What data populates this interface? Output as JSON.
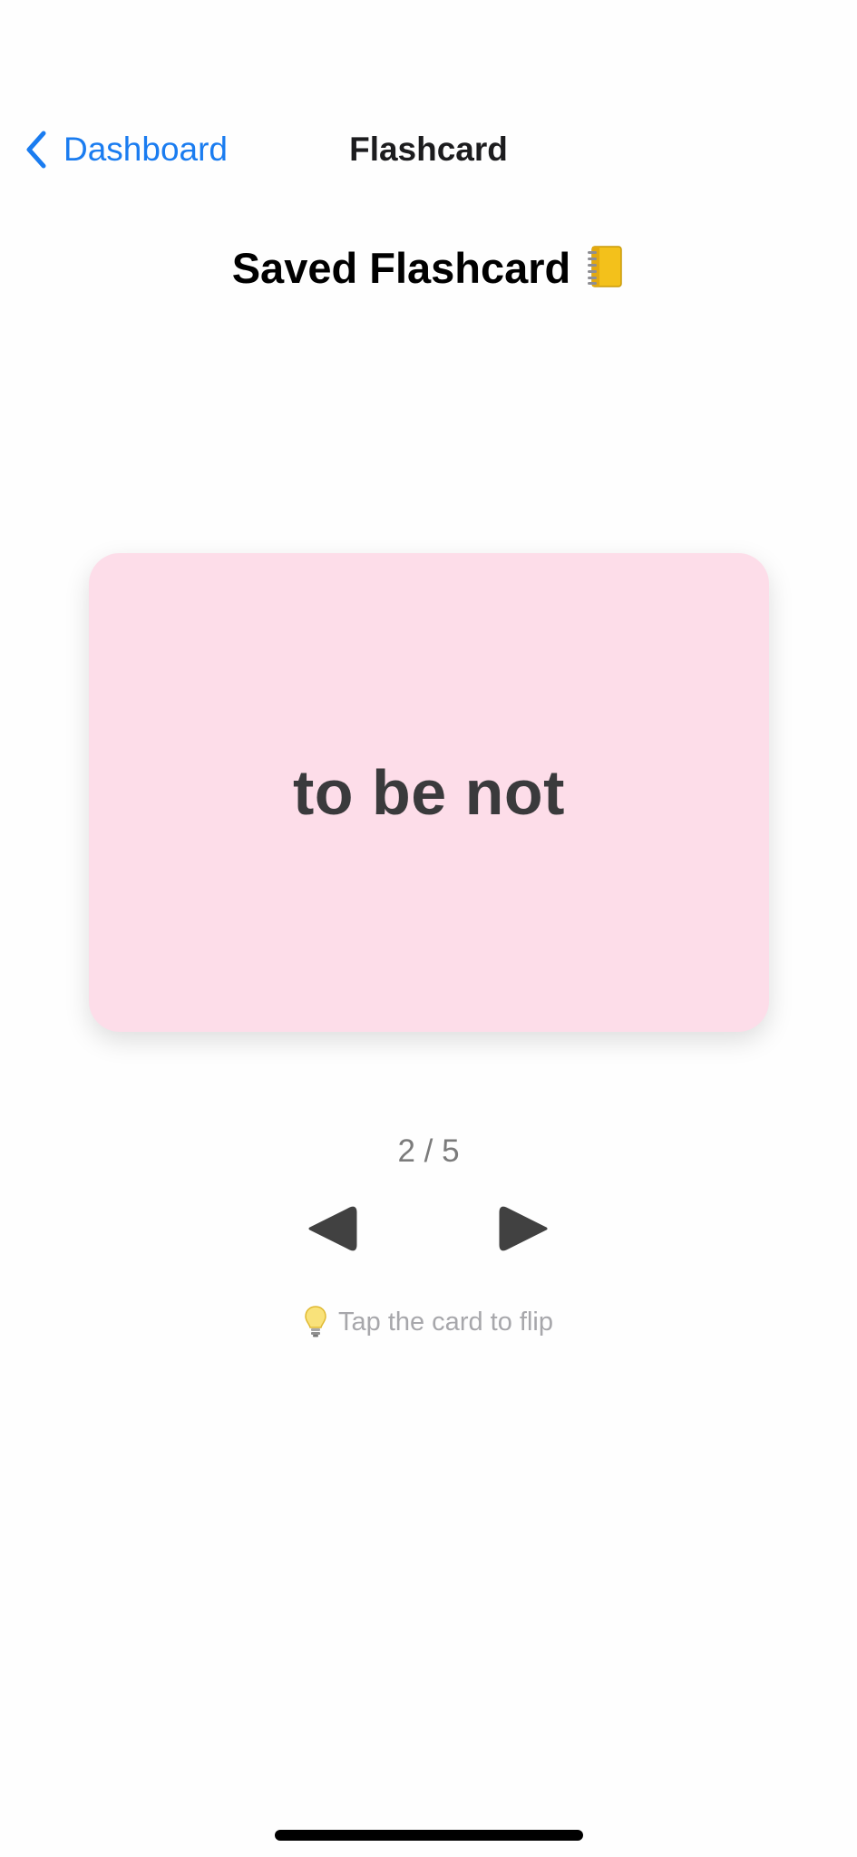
{
  "nav": {
    "back_label": "Dashboard",
    "title": "Flashcard"
  },
  "page": {
    "heading": "Saved Flashcard",
    "heading_icon": "notebook-icon"
  },
  "card": {
    "text": "to be not",
    "background_color": "#fddde9"
  },
  "pager": {
    "counter": "2 / 5",
    "current": 2,
    "total": 5,
    "prev_icon": "triangle-left-icon",
    "next_icon": "triangle-right-icon"
  },
  "hint": {
    "icon": "lightbulb-icon",
    "text": "Tap the card to flip"
  },
  "colors": {
    "accent": "#1a7cf0",
    "card": "#fddde9",
    "arrow": "#414141"
  }
}
